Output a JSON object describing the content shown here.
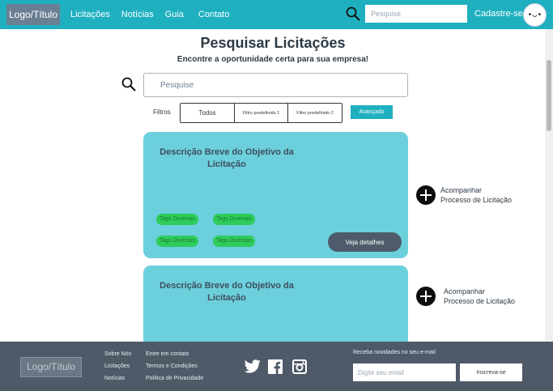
{
  "header": {
    "logo": "Logo/Título",
    "nav": [
      "Licitações",
      "Notícias",
      "Guia",
      "Contato"
    ],
    "search_placeholder": "Pesquise",
    "signup": "Cadastre-se",
    "avatar_face": "•ᴗ•"
  },
  "main": {
    "title": "Pesquisar Licitações",
    "subtitle": "Encontre a oportunidade certa para sua empresa!",
    "search_placeholder": "Pesquise",
    "filters_label": "Filtros",
    "filters": [
      "Todos",
      "Filtro predefinido 1",
      "Filtro predefinido 2"
    ],
    "advanced": "Avançado"
  },
  "cards": [
    {
      "title": "Descrição Breve do Objetivo da Licitação",
      "tags": [
        "Tags Diversas",
        "Tags Diversas",
        "Tags Diversas",
        "Tags Diversas"
      ],
      "details_label": "Veja detalhes",
      "follow_line1": "Acompanhar",
      "follow_line2": "Processo de Licitação"
    },
    {
      "title": "Descrição Breve do Objetivo da Licitação",
      "follow_line1": "Acompanhar",
      "follow_line2": "Processo de Licitação"
    }
  ],
  "footer": {
    "logo": "Logo/Título",
    "col1": [
      "Sobre Nós",
      "Licitações",
      "Notícias"
    ],
    "col2": [
      "Entre em contato",
      "Termos e Condições",
      "Política de Privacidade"
    ],
    "social_icons": [
      "twitter-icon",
      "facebook-icon",
      "instagram-icon"
    ],
    "newsletter_label": "Receba novidades no seu e-mail",
    "newsletter_placeholder": "Digite seu email",
    "subscribe": "Inscreva-se"
  },
  "colors": {
    "primary": "#1fb0c0",
    "card": "#6ccfdc",
    "tag": "#2ecc5a",
    "footer": "#4e5a68",
    "dark_button": "#4d5b6a"
  }
}
